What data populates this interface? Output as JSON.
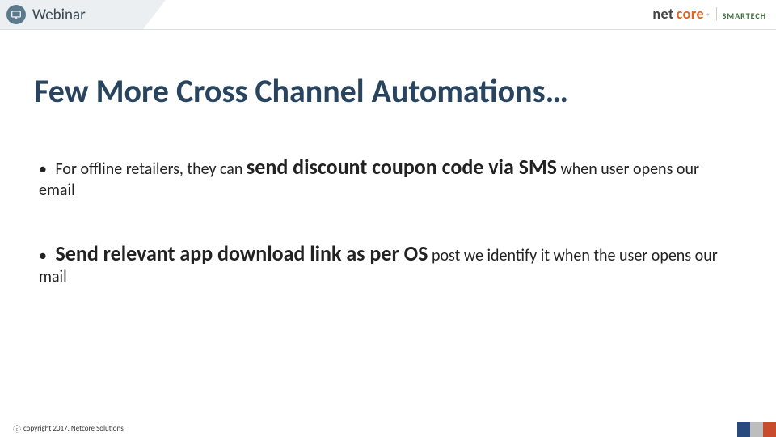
{
  "header": {
    "webinar_label": "Webinar",
    "brand_part1": "net",
    "brand_part2": "core",
    "brand_sub": "SMARTECH"
  },
  "title": "Few More Cross Channel Automations…",
  "bullets": [
    {
      "pre": "For offline retailers, they can ",
      "bold": "send discount coupon code via SMS",
      "post": " when user opens our email"
    },
    {
      "pre": "",
      "bold": "Send relevant app download link as per OS",
      "post": " post we identify it when the user opens our mail"
    }
  ],
  "footer": {
    "copyright": "copyright 2017. Netcore Solutions"
  }
}
